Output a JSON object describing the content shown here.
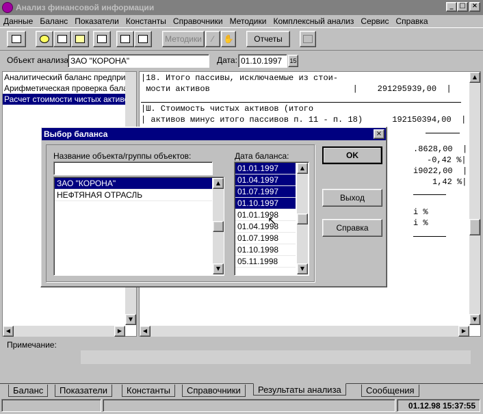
{
  "window": {
    "title": "Анализ финансовой информации",
    "minimize": "_",
    "maximize": "□",
    "close": "×"
  },
  "menu": [
    "Данные",
    "Баланс",
    "Показатели",
    "Константы",
    "Справочники",
    "Методики",
    "Комплексный анализ",
    "Сервис",
    "Справка"
  ],
  "toolbar": {
    "methods_label": "Методики",
    "reports_label": "Отчеты"
  },
  "header": {
    "object_label": "Объект анализа:",
    "object_value": "ЗАО \"КОРОНА\"",
    "date_label": "Дата:",
    "date_value": "01.10.1997",
    "calendar_icon": "15"
  },
  "left_list": [
    "Аналитический баланс предприятия",
    "Арифметическая проверка баланса",
    "Расчет стоимости чистых активов"
  ],
  "report_lines": [
    "|18. Итого пассивы, исключаемые из стои-",
    " мости активов                             |    291295939,00  |",
    "|Ш. Стоимость чистых активов (итого",
    "| активов минус итого пассивов п. 11 - п. 18)      192150394,00  |",
    ".8628,00  |",
    "-0,42 %|",
    "i9022,00  |",
    "1,42 %|",
    "i %",
    "i %"
  ],
  "note_label": "Примечание:",
  "tabs": [
    "Баланс",
    "Показатели",
    "Константы",
    "Справочники",
    "Результаты анализа",
    "Сообщения"
  ],
  "active_tab": "Результаты анализа",
  "status": {
    "datetime": "01.12.98 15:37:55"
  },
  "dialog": {
    "title": "Выбор баланса",
    "name_label": "Название объекта/группы объектов:",
    "name_input_value": "",
    "objects": [
      "ЗАО \"КОРОНА\"",
      "НЕФТЯНАЯ ОТРАСЛЬ"
    ],
    "date_label": "Дата баланса:",
    "dates": [
      "01.01.1997",
      "01.04.1997",
      "01.07.1997",
      "01.10.1997",
      "01.01.1998",
      "01.04.1998",
      "01.07.1998",
      "01.10.1998",
      "05.11.1998"
    ],
    "ok_label": "OK",
    "exit_label": "Выход",
    "help_label": "Справка"
  },
  "colors": {
    "selection": "#000080",
    "face": "#c0c0c0",
    "title_inactive": "#808080"
  }
}
